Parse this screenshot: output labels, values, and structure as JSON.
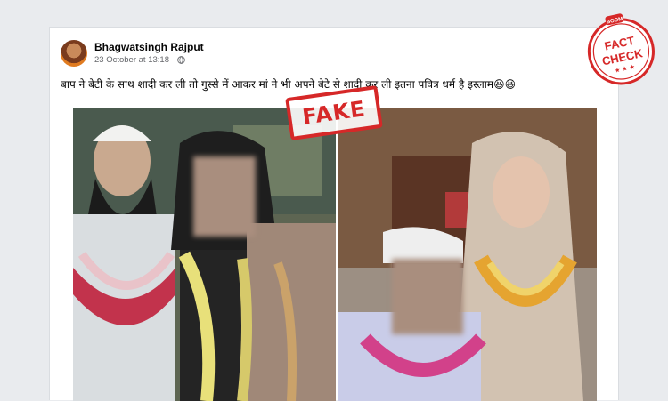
{
  "post": {
    "author": "Bhagwatsingh Rajput",
    "timestamp": "23 October at 13:18",
    "separator": "·",
    "text": "बाप ने बेटी के साथ शादी कर ली तो गुस्से में आकर मां ने भी अपने बेटे से शादी कर ली इतना पवित्र धर्म है इस्लाम😆😆",
    "menu_icon": "more-options-icon"
  },
  "stamps": {
    "fake_label": "FAKE",
    "badge_line1": "FACT",
    "badge_line2": "CHECK",
    "badge_brand": "BOOM"
  },
  "colors": {
    "stamp_red": "#d62828",
    "feed_bg": "#e9ebee"
  }
}
